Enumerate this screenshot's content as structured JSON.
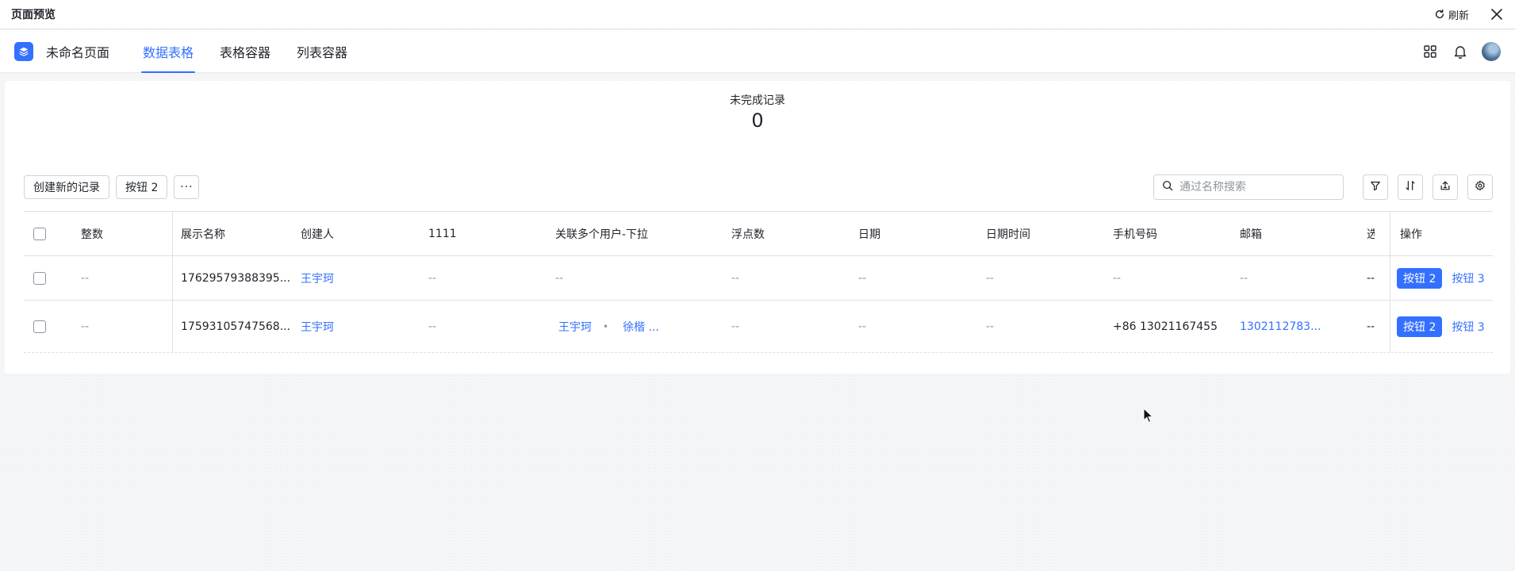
{
  "preview_bar": {
    "title": "页面预览",
    "refresh_label": "刷新"
  },
  "app": {
    "name": "未命名页面",
    "tabs": [
      {
        "label": "数据表格",
        "active": true
      },
      {
        "label": "表格容器",
        "active": false
      },
      {
        "label": "列表容器",
        "active": false
      }
    ]
  },
  "stat": {
    "label": "未完成记录",
    "value": "0"
  },
  "toolbar": {
    "create_label": "创建新的记录",
    "button2_label": "按钮 2",
    "more_label": "···",
    "search_placeholder": "通过名称搜索"
  },
  "table": {
    "headers": {
      "int": "整数",
      "name": "展示名称",
      "creator": "创建人",
      "c1111": "1111",
      "users": "关联多个用户-下拉",
      "float": "浮点数",
      "date": "日期",
      "datetime": "日期时间",
      "phone": "手机号码",
      "email": "邮箱",
      "more": "选",
      "ops": "操作"
    },
    "rows": [
      {
        "int": "--",
        "name": "17629579388395...",
        "creator": "王宇珂",
        "c1111": "--",
        "users": "--",
        "float": "--",
        "date": "--",
        "datetime": "--",
        "phone": "--",
        "email": "--",
        "more": "--",
        "op_primary": "按钮 2",
        "op_link": "按钮 3"
      },
      {
        "int": "--",
        "name": "17593105747568...",
        "creator": "王宇珂",
        "c1111": "--",
        "users_list": [
          "王宇珂",
          "徐楷 ..."
        ],
        "users_sep": "•",
        "float": "--",
        "date": "--",
        "datetime": "--",
        "phone": "+86 13021167455",
        "email": "1302112783...",
        "more": "--",
        "op_primary": "按钮 2",
        "op_link": "按钮 3"
      }
    ]
  },
  "colors": {
    "accent": "#3370ff",
    "text": "#1f2329",
    "muted": "#8f959e",
    "border": "#dee0e3"
  },
  "icons": [
    "refresh-icon",
    "close-icon",
    "app-logo-icon",
    "apps-grid-icon",
    "bell-icon",
    "search-icon",
    "filter-icon",
    "sort-icon",
    "export-icon",
    "settings-icon"
  ]
}
